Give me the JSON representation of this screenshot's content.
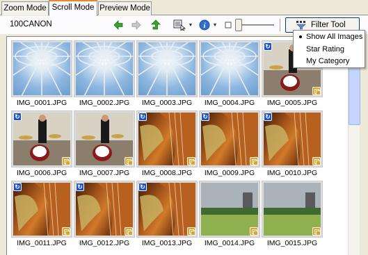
{
  "tabs": [
    {
      "label": "Zoom Mode",
      "active": false
    },
    {
      "label": "Scroll Mode",
      "active": true
    },
    {
      "label": "Preview Mode",
      "active": false
    }
  ],
  "toolbar": {
    "folder": "100CANON",
    "icons": [
      "back-arrow-icon",
      "forward-arrow-icon",
      "up-folder-icon",
      "select-icon",
      "info-icon",
      "zoom-slider"
    ],
    "filter_label": "Filter Tool"
  },
  "filter_menu": {
    "items": [
      {
        "label": "Show All Images",
        "selected": true
      },
      {
        "label": "Star Rating",
        "selected": false
      },
      {
        "label": "My Category",
        "selected": false
      }
    ]
  },
  "thumbnails": [
    {
      "name": "IMG_0001.JPG",
      "type": "dome",
      "rotated": false,
      "copied": false
    },
    {
      "name": "IMG_0002.JPG",
      "type": "dome",
      "rotated": false,
      "copied": false
    },
    {
      "name": "IMG_0003.JPG",
      "type": "dome",
      "rotated": false,
      "copied": false
    },
    {
      "name": "IMG_0004.JPG",
      "type": "dome",
      "rotated": false,
      "copied": false
    },
    {
      "name": "IMG_0005.JPG",
      "type": "stage",
      "rotated": true,
      "copied": true
    },
    {
      "name": "IMG_0006.JPG",
      "type": "stage",
      "rotated": true,
      "copied": true
    },
    {
      "name": "IMG_0007.JPG",
      "type": "stage",
      "rotated": false,
      "copied": true
    },
    {
      "name": "IMG_0008.JPG",
      "type": "violin",
      "rotated": true,
      "copied": true
    },
    {
      "name": "IMG_0009.JPG",
      "type": "violin",
      "rotated": true,
      "copied": true
    },
    {
      "name": "IMG_0010.JPG",
      "type": "violin",
      "rotated": true,
      "copied": true
    },
    {
      "name": "IMG_0011.JPG",
      "type": "violin",
      "rotated": true,
      "copied": true
    },
    {
      "name": "IMG_0012.JPG",
      "type": "violin",
      "rotated": true,
      "copied": true
    },
    {
      "name": "IMG_0013.JPG",
      "type": "violin",
      "rotated": true,
      "copied": true
    },
    {
      "name": "IMG_0014.JPG",
      "type": "land",
      "rotated": false,
      "copied": true
    },
    {
      "name": "IMG_0015.JPG",
      "type": "land",
      "rotated": false,
      "copied": true
    }
  ],
  "colors": {
    "accent_tab": "#e68b2c",
    "rotate_badge": "#1a4fd0",
    "copy_badge": "#e6a020",
    "window_bg": "#ece9d8"
  }
}
